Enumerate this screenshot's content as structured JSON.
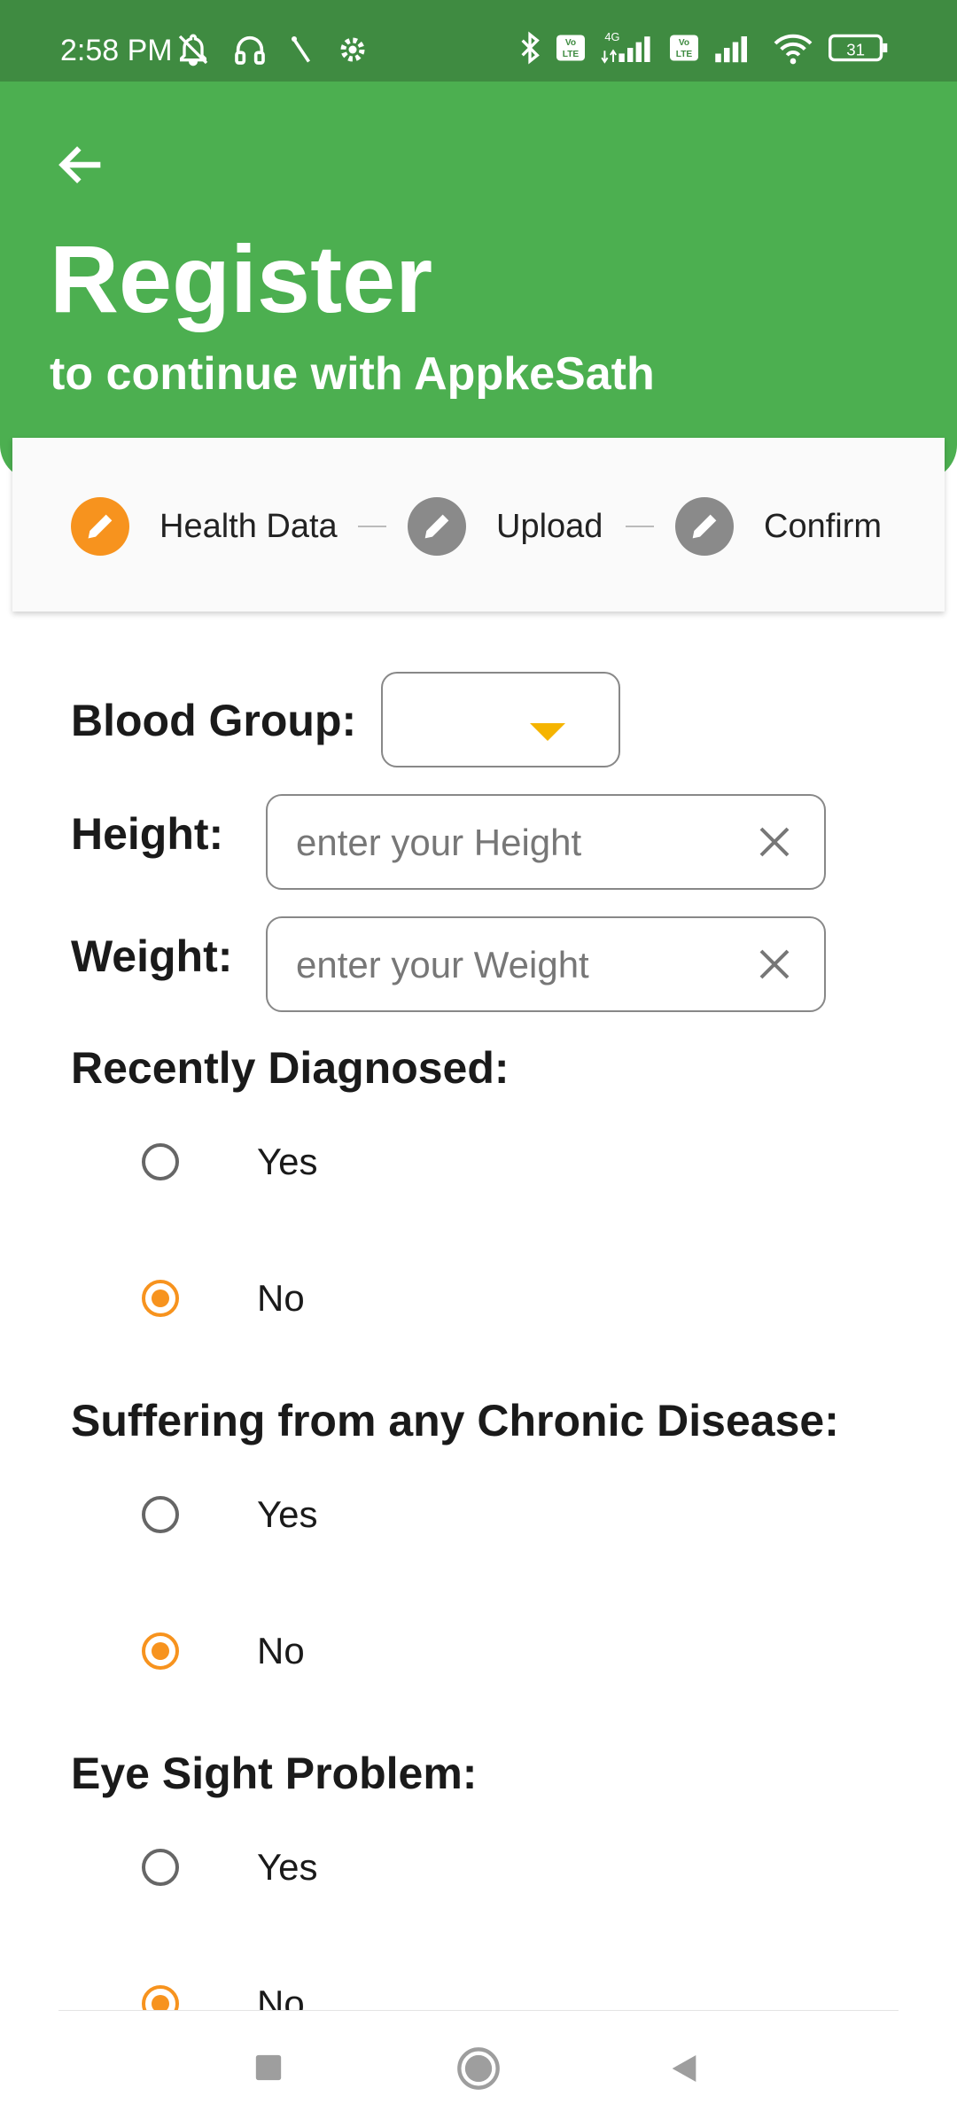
{
  "status_bar": {
    "time": "2:58 PM",
    "network": "4G",
    "battery": "31",
    "icons": [
      "mute-icon",
      "headset-icon",
      "signal-slash-icon",
      "gear-icon",
      "bluetooth-icon",
      "volte-icon",
      "signal-icon",
      "volte-icon",
      "signal-icon",
      "wifi-icon",
      "battery-icon"
    ]
  },
  "header": {
    "title": "Register",
    "subtitle": "to continue with AppkeSath",
    "back_icon": "arrow-left-icon",
    "color": "#4caf50"
  },
  "stepper": {
    "steps": [
      {
        "label": "Health Data",
        "active": true,
        "icon": "pencil-icon"
      },
      {
        "label": "Upload",
        "active": false,
        "icon": "pencil-icon"
      },
      {
        "label": "Confirm",
        "active": false,
        "icon": "pencil-icon"
      }
    ],
    "active_color": "#f7931e",
    "inactive_color": "#8a8a8a"
  },
  "form": {
    "blood_group": {
      "label": "Blood Group:",
      "value": ""
    },
    "height": {
      "label": "Height:",
      "placeholder": "enter your Height",
      "value": ""
    },
    "weight": {
      "label": "Weight:",
      "placeholder": "enter your Weight",
      "value": ""
    },
    "questions": [
      {
        "label": "Recently Diagnosed:",
        "options": [
          "Yes",
          "No"
        ],
        "selected": "No"
      },
      {
        "label": "Suffering from any Chronic Disease:",
        "options": [
          "Yes",
          "No"
        ],
        "selected": "No"
      },
      {
        "label": "Eye Sight Problem:",
        "options": [
          "Yes",
          "No"
        ],
        "selected": "No"
      }
    ]
  },
  "nav_bar": {
    "buttons": [
      "recents-icon",
      "home-icon",
      "back-icon"
    ]
  }
}
